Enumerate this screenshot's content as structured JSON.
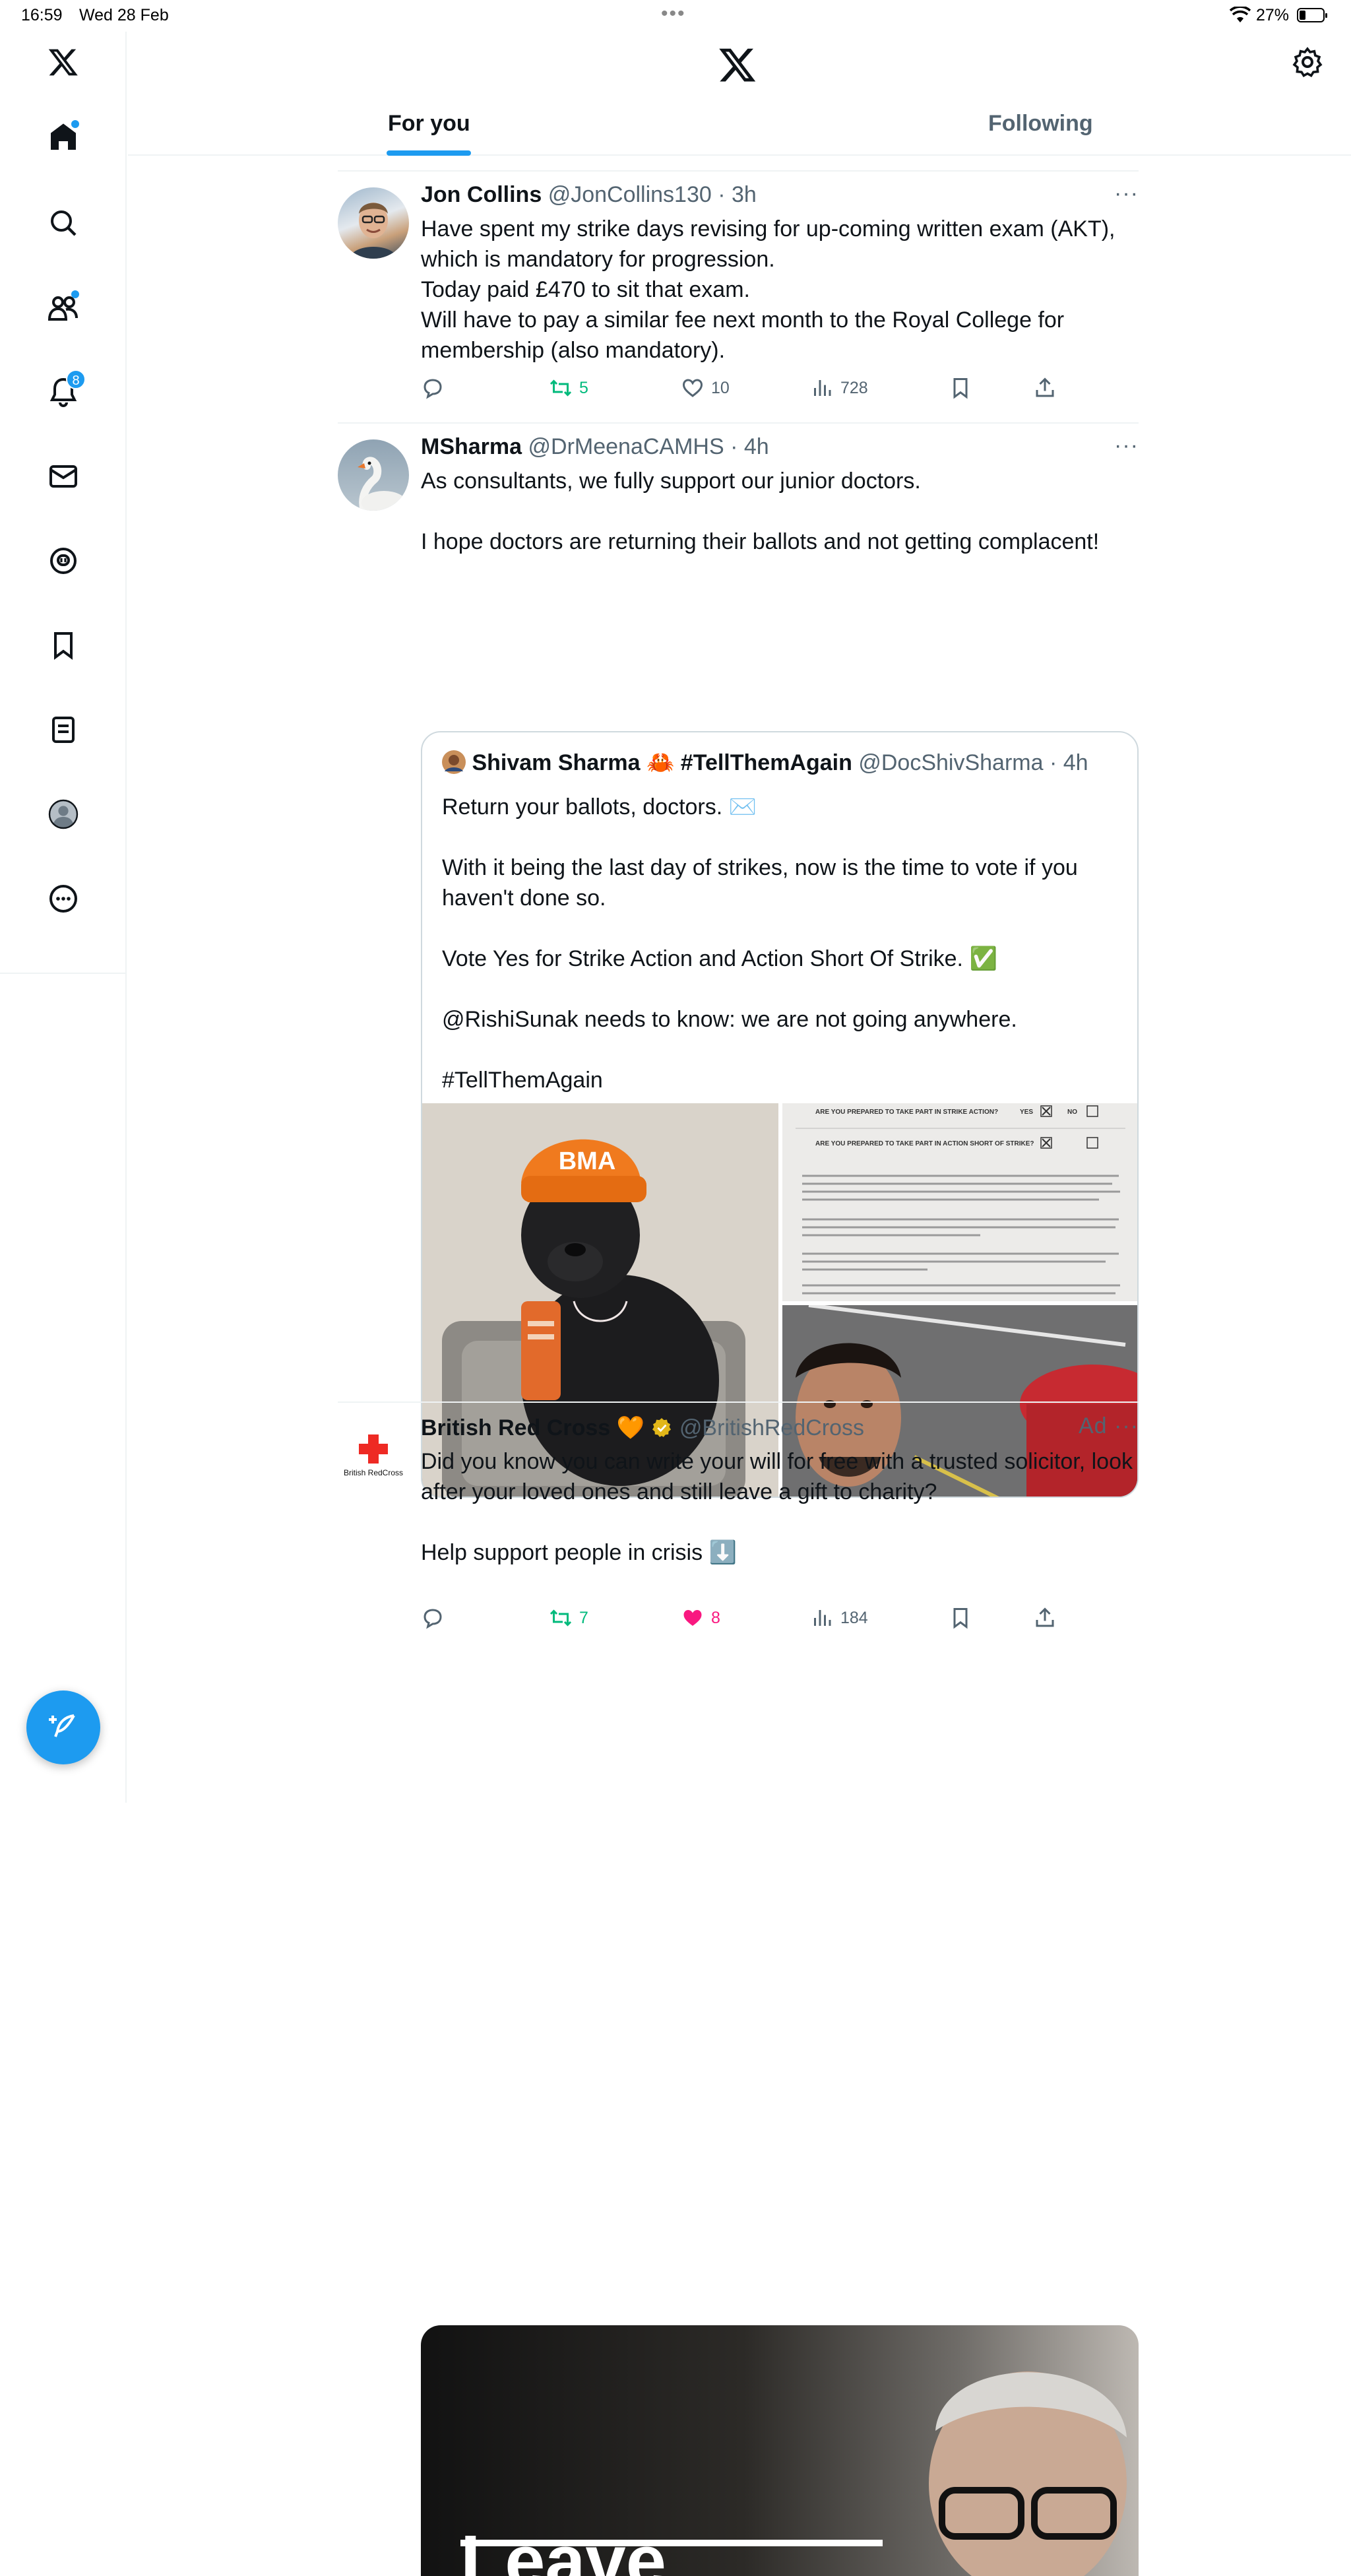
{
  "status_bar": {
    "time": "16:59",
    "date": "Wed 28 Feb",
    "battery": "27%"
  },
  "sidebar": {
    "items": [
      {
        "name": "x-logo"
      },
      {
        "name": "home"
      },
      {
        "name": "search"
      },
      {
        "name": "communities"
      },
      {
        "name": "notifications",
        "badge": "8"
      },
      {
        "name": "messages"
      },
      {
        "name": "grok"
      },
      {
        "name": "bookmarks"
      },
      {
        "name": "lists"
      },
      {
        "name": "profile"
      },
      {
        "name": "more"
      }
    ]
  },
  "tabs": [
    {
      "label": "For you",
      "active": true
    },
    {
      "label": "Following",
      "active": false
    }
  ],
  "tweets": [
    {
      "name": "Jon Collins",
      "handle": "@JonCollins130",
      "time": "3h",
      "text": "Have spent my strike days revising for up-coming written exam (AKT), which is mandatory for progression.\nToday paid £470 to sit that exam.\nWill have to pay a similar fee next month to the Royal College for membership (also mandatory).",
      "reposts": "5",
      "likes": "10",
      "views": "728"
    },
    {
      "name": "MSharma",
      "handle": "@DrMeenaCAMHS",
      "time": "4h",
      "text": "As consultants, we fully support our junior doctors.\n\nI hope doctors are returning their ballots and not getting complacent!",
      "quote": {
        "name": "Shivam Sharma 🦀 #TellThemAgain",
        "handle": "@DocShivSharma",
        "time": "4h",
        "text": "Return your ballots, doctors. ✉️\n\nWith it being the last day of strikes, now is the time to vote if you haven't done so.\n\nVote Yes for Strike Action and Action Short Of Strike. ✅\n\n@RishiSunak needs to know: we are not going anywhere.\n\n#TellThemAgain"
      },
      "image_text": {
        "hat": "BMA",
        "ballot_q1": "ARE YOU PREPARED TO TAKE PART IN STRIKE ACTION?",
        "ballot_q2": "ARE YOU PREPARED TO TAKE PART IN ACTION SHORT OF STRIKE?",
        "yes": "YES",
        "no": "NO"
      },
      "reposts": "7",
      "likes": "8",
      "views": "184"
    },
    {
      "name": "British Red Cross 🧡",
      "handle": "@BritishRedCross",
      "ad_label": "Ad",
      "logo_text": "British RedCross",
      "text": "Did you know you can write your will for free with a trusted solicitor, look after your loved ones and still leave a gift to charity?\n\nHelp support people in crisis ⬇️",
      "image_caption": "Leave"
    }
  ],
  "colors": {
    "accent": "#1d9bf0",
    "repost": "#00ba7c",
    "like": "#f91880",
    "secondary": "#536471"
  }
}
